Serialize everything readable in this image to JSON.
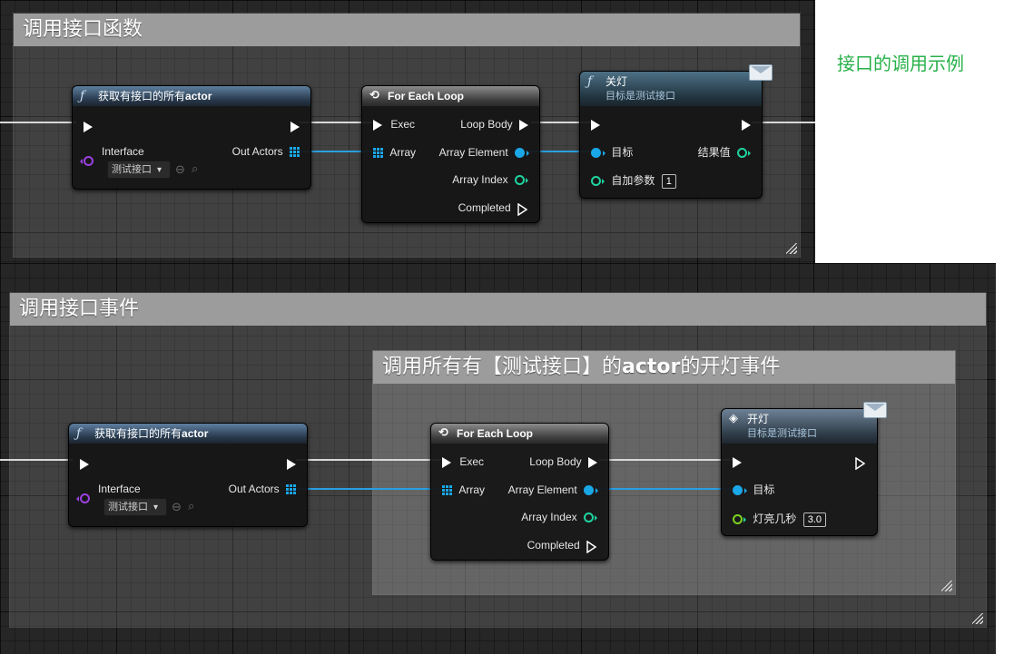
{
  "side_note": "接口的调用示例",
  "top": {
    "comment_title": "调用接口函数",
    "get_node": {
      "title_prefix": "获取有接口的所有",
      "title_bold": "actor",
      "interface_label": "Interface",
      "interface_value": "测试接口",
      "out_label": "Out Actors"
    },
    "loop_node": {
      "title": "For Each Loop",
      "exec": "Exec",
      "array": "Array",
      "loop_body": "Loop Body",
      "array_element": "Array Element",
      "array_index": "Array Index",
      "completed": "Completed"
    },
    "call_node": {
      "title": "关灯",
      "subtitle": "目标是测试接口",
      "target": "目标",
      "result": "结果值",
      "param_label": "自加参数",
      "param_value": "1"
    }
  },
  "bottom": {
    "comment_title": "调用接口事件",
    "inner_comment_title_prefix": "调用所有有【测试接口】的",
    "inner_comment_title_bold": "actor",
    "inner_comment_title_suffix": "的开灯事件",
    "get_node": {
      "title_prefix": "获取有接口的所有",
      "title_bold": "actor",
      "interface_label": "Interface",
      "interface_value": "测试接口",
      "out_label": "Out Actors"
    },
    "loop_node": {
      "title": "For Each Loop",
      "exec": "Exec",
      "array": "Array",
      "loop_body": "Loop Body",
      "array_element": "Array Element",
      "array_index": "Array Index",
      "completed": "Completed"
    },
    "event_node": {
      "title": "开灯",
      "subtitle": "目标是测试接口",
      "target": "目标",
      "param_label": "灯亮几秒",
      "param_value": "3.0"
    }
  },
  "colors": {
    "exec_wire": "#d8d8d8",
    "object_wire": "#2a9fe0",
    "int_pin": "#1fd39f",
    "interface_pin": "#9b41e0",
    "note_text": "#28b14a"
  }
}
